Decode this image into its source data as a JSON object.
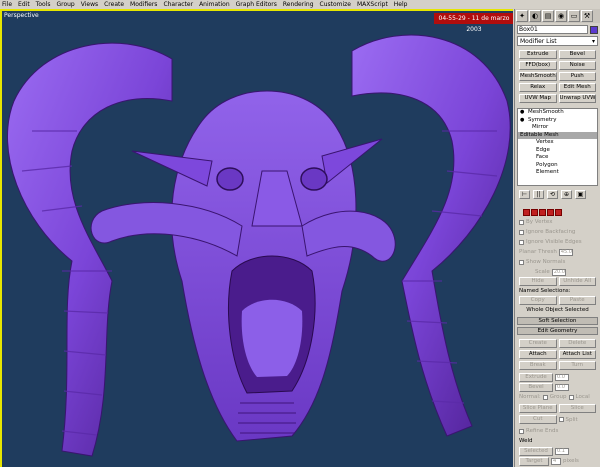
{
  "menu": [
    "File",
    "Edit",
    "Tools",
    "Group",
    "Views",
    "Create",
    "Modifiers",
    "Character",
    "Animation",
    "Graph Editors",
    "Rendering",
    "Customize",
    "MAXScript",
    "Help"
  ],
  "viewport": {
    "label": "Perspective",
    "timestamp": "04-55-29 - 11 de marzo 2003"
  },
  "panel": {
    "tabs": [
      "create-icon",
      "modify-icon",
      "hierarchy-icon",
      "motion-icon",
      "display-icon",
      "utilities-icon"
    ],
    "tab_glyphs": [
      "✦",
      "◐",
      "▤",
      "◉",
      "▭",
      "⚒"
    ],
    "object_name": "Box01",
    "object_color": "#5b3ad0",
    "modifier_list": "Modifier List",
    "modifier_buttons": [
      [
        "Extrude",
        "Bevel"
      ],
      [
        "FFD(box)",
        "Noise"
      ],
      [
        "MeshSmooth",
        "Push"
      ],
      [
        "Relax",
        "Edit Mesh"
      ],
      [
        "UVW Map",
        "Unwrap UVW"
      ]
    ],
    "stack": {
      "meshsmooth": "MeshSmooth",
      "symmetry": "Symmetry",
      "mirror": "Mirror",
      "editable_mesh": "Editable Mesh",
      "subobjects": [
        "Vertex",
        "Edge",
        "Face",
        "Polygon",
        "Element"
      ]
    },
    "stack_tools": [
      "⊢",
      "||",
      "⟲",
      "⊕",
      "▣"
    ],
    "selection": {
      "by_vertex": "By Vertex",
      "ignore_backfacing": "Ignore Backfacing",
      "ignore_visible_edges": "Ignore Visible Edges",
      "planar_thresh": "Planar Thresh",
      "planar_value": "45.0",
      "show_normals": "Show Normals",
      "scale": "Scale",
      "scale_value": "20.0",
      "hide": "Hide",
      "unhide_all": "Unhide All",
      "named_selections": "Named Selections:",
      "copy": "Copy",
      "paste": "Paste",
      "whole_object": "Whole Object Selected"
    },
    "rollouts": {
      "soft_selection": "Soft Selection",
      "edit_geometry": "Edit Geometry"
    },
    "edit_geometry": {
      "create": "Create",
      "delete": "Delete",
      "attach": "Attach",
      "attach_list": "Attach List",
      "break": "Break",
      "turn": "Turn",
      "extrude": "Extrude",
      "extrude_value": "0.0",
      "bevel": "Bevel",
      "bevel_value": "0.0",
      "normal": "Normal:",
      "group": "Group",
      "local": "Local",
      "slice_plane": "Slice Plane",
      "slice": "Slice",
      "cut": "Cut",
      "split": "Split",
      "refine_ends": "Refine Ends",
      "weld": "Weld",
      "selected": "Selected",
      "selected_value": "0.1",
      "target": "Target",
      "target_value": "4",
      "pixels": "pixels"
    }
  }
}
